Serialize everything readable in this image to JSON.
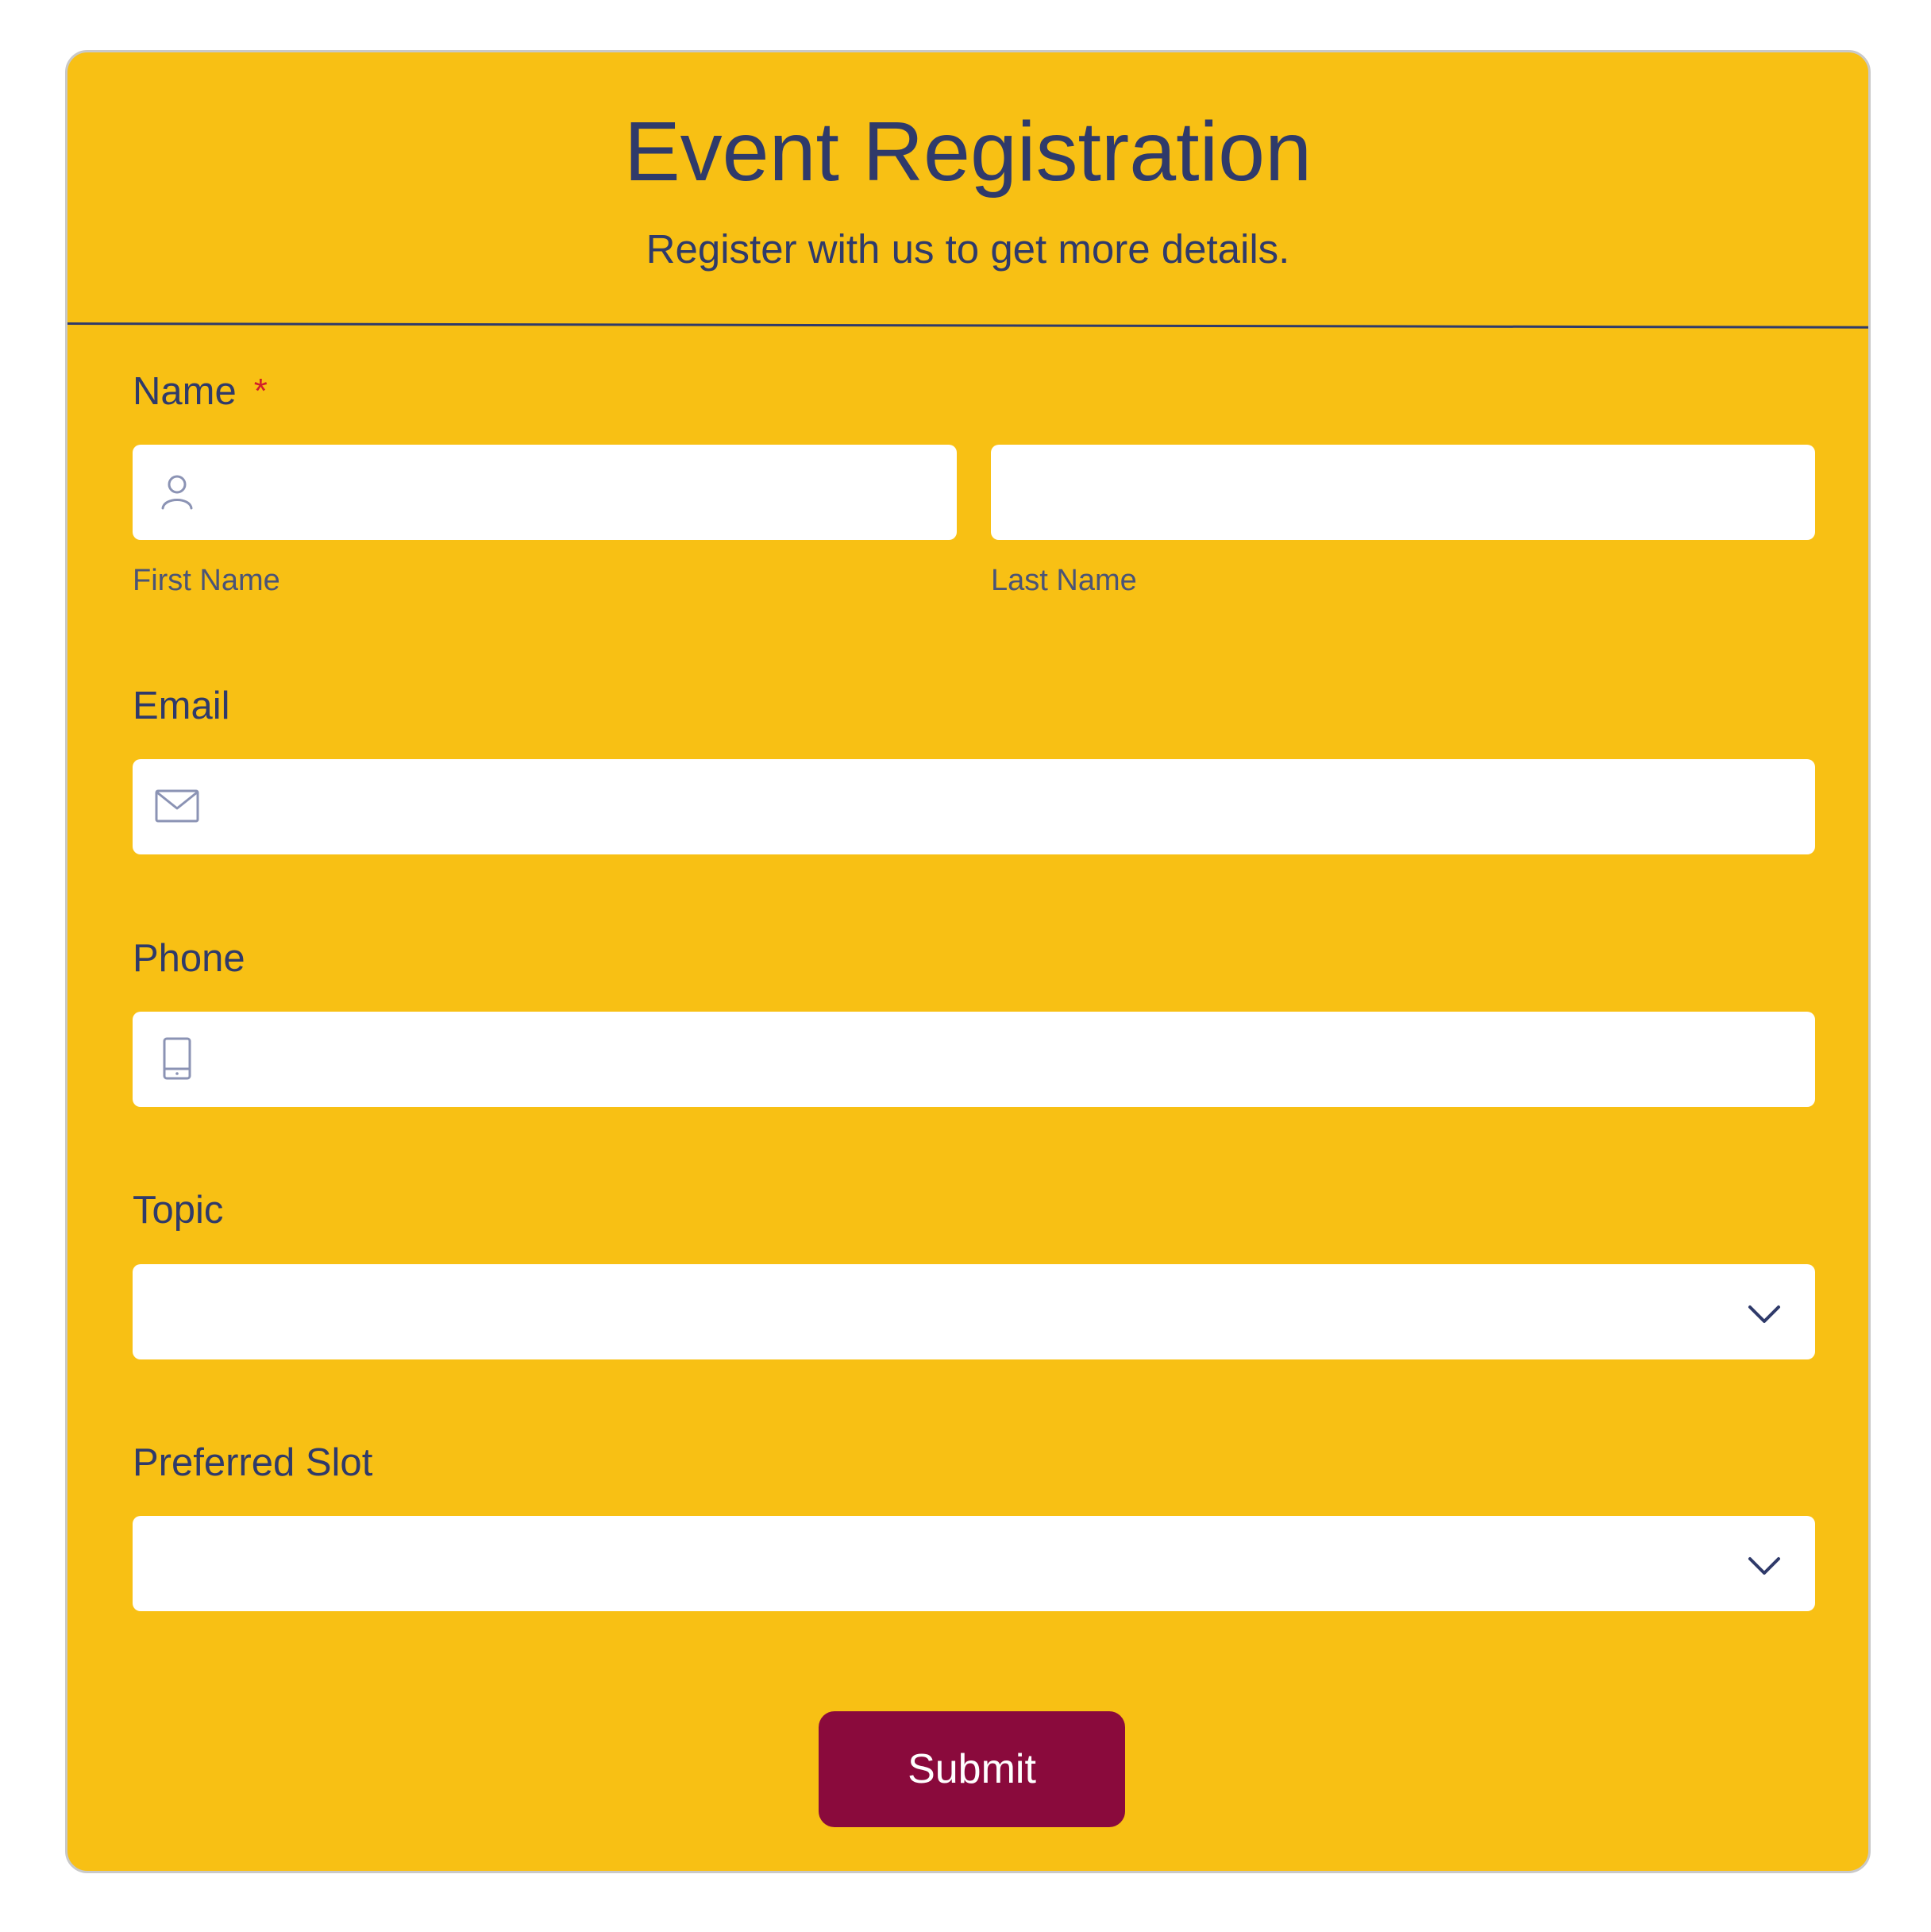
{
  "form": {
    "title": "Event Registration",
    "subtitle": "Register with us to get more details.",
    "name": {
      "label": "Name",
      "required_mark": "*",
      "first_sublabel": "First Name",
      "last_sublabel": "Last Name",
      "first_value": "",
      "last_value": ""
    },
    "email": {
      "label": "Email",
      "value": ""
    },
    "phone": {
      "label": "Phone",
      "value": ""
    },
    "topic": {
      "label": "Topic",
      "selected": ""
    },
    "slot": {
      "label": "Preferred Slot",
      "selected": ""
    },
    "submit_label": "Submit"
  },
  "colors": {
    "background": "#f8c014",
    "text": "#2f3a6a",
    "button": "#8a0a3c",
    "required": "#d21e2b"
  },
  "icons": {
    "first_name": "user-icon",
    "email": "envelope-icon",
    "phone": "mobile-phone-icon",
    "dropdown": "chevron-down-icon"
  }
}
